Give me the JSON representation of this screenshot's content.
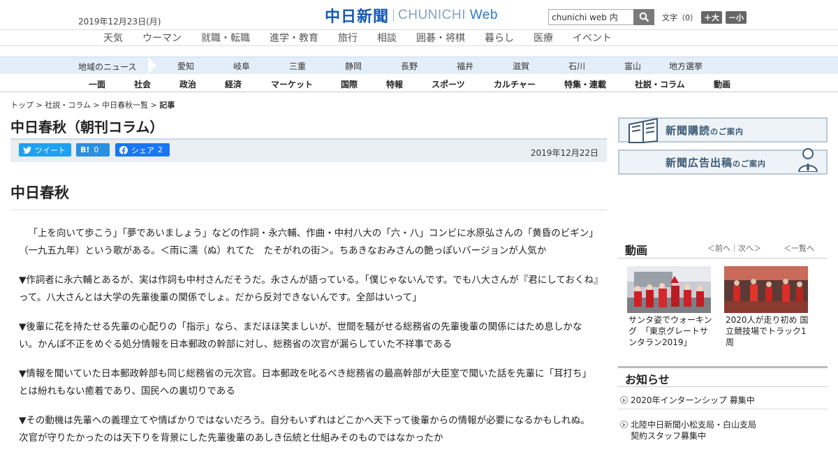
{
  "header": {
    "date": "2019年12月23日(月)",
    "logo_main": "中日新聞",
    "logo_sub_a": "CHUNICHI ",
    "logo_sub_b": "Web",
    "search_value": "chunichi web 内",
    "font_label": "文字（0）",
    "font_plus": "＋大",
    "font_minus": "－小"
  },
  "subnav": [
    "天気",
    "ウーマン",
    "就職・転職",
    "進学・教育",
    "旅行",
    "相談",
    "囲碁・将棋",
    "暮らし",
    "医療",
    "イベント"
  ],
  "regional": {
    "label": "地域のニュース",
    "items": [
      "愛知",
      "岐阜",
      "三重",
      "静岡",
      "長野",
      "福井",
      "滋賀",
      "石川",
      "富山",
      "地方選挙"
    ]
  },
  "categories": [
    "一面",
    "社会",
    "政治",
    "経済",
    "マーケット",
    "国際",
    "特報",
    "スポーツ",
    "カルチャー",
    "特集・連載",
    "社説・コラム",
    "動画"
  ],
  "breadcrumb": {
    "a": "トップ",
    "b": "社説・コラム",
    "c": "中日春秋一覧",
    "cur": "記事",
    "sep": " > "
  },
  "article": {
    "title": "中日春秋（朝刊コラム）",
    "tweet": "ツイート",
    "hatena": "0",
    "share": "シェア",
    "share_count": "2",
    "date": "2019年12月22日",
    "heading": "中日春秋",
    "paragraphs": [
      "「上を向いて歩こう」「夢であいましょう」などの作詞・永六輔、作曲・中村八大の「六・八」コンビに水原弘さんの「黄昏のビギン」（一九五九年）という歌がある。＜雨に濡（ぬ）れてた　たそがれの街＞。ちあきなおみさんの艶っぽいバージョンが人気か",
      "▼作詞者に永六輔とあるが、実は作詞も中村さんだそうだ。永さんが語っている。「僕じゃないんです。でも八大さんが『君にしておくね』って。八大さんとは大学の先輩後輩の関係でしょ。だから反対できないんです。全部はいって」",
      "▼後輩に花を持たせる先輩の心配りの「指示」なら、まだほほ笑ましいが、世間を騒がせる総務省の先輩後輩の関係にはため息しかない。かんぽ不正をめぐる処分情報を日本郵政の幹部に対し、総務省の次官が漏らしていた不祥事である",
      "▼情報を聞いていた日本郵政幹部も同じ総務省の元次官。日本郵政を叱るべき総務省の最高幹部が大臣室で聞いた話を先輩に「耳打ち」とは紛れもない癒着であり、国民への裏切りである",
      "▼その動機は先輩への義理立てや情ばかりではないだろう。自分もいずれはどこかへ天下って後輩からの情報が必要になるかもしれぬ。次官が守りたかったのは天下りを背景にした先輩後輩のあしき伝統と仕組みそのものではなかったか"
    ]
  },
  "sidebar": {
    "ad1_main": "新聞購読",
    "ad1_small": "のご案内",
    "ad2_main": "新聞広告出稿",
    "ad2_small": "のご案内",
    "video_title": "動画",
    "video_prevnext": "＜前へ｜次へ＞",
    "video_list": "＜一覧へ",
    "videos": [
      "サンタ姿でウォーキング　「東京グレートサンタラン2019」",
      "2020人が走り初め 国立競技場でトラック1周"
    ],
    "news_title": "お知らせ",
    "news": [
      "2020年インターンシップ 募集中",
      "北陸中日新聞小松支局・白山支局",
      "契約スタッフ募集中"
    ]
  }
}
